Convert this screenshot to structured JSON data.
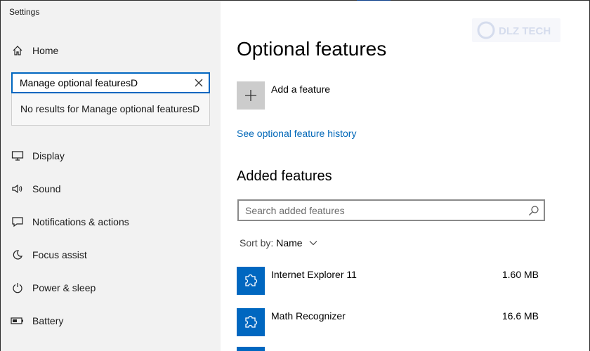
{
  "window": {
    "title": "Settings"
  },
  "sidebar": {
    "home_label": "Home",
    "search": {
      "value": "Manage optional featuresD",
      "no_results": "No results for Manage optional featuresD"
    },
    "items": [
      {
        "label": "Display",
        "icon": "display-icon"
      },
      {
        "label": "Sound",
        "icon": "sound-icon"
      },
      {
        "label": "Notifications & actions",
        "icon": "notifications-icon"
      },
      {
        "label": "Focus assist",
        "icon": "focus-assist-icon"
      },
      {
        "label": "Power & sleep",
        "icon": "power-icon"
      },
      {
        "label": "Battery",
        "icon": "battery-icon"
      }
    ]
  },
  "main": {
    "title": "Optional features",
    "add_feature_label": "Add a feature",
    "history_link": "See optional feature history",
    "added_section_title": "Added features",
    "search_placeholder": "Search added features",
    "sort_label": "Sort by:",
    "sort_value": "Name",
    "features": [
      {
        "name": "Internet Explorer 11",
        "size": "1.60 MB"
      },
      {
        "name": "Math Recognizer",
        "size": "16.6 MB"
      }
    ]
  },
  "watermark": {
    "text": "DLZ TECH"
  },
  "colors": {
    "accent": "#0067c0",
    "link": "#0067b8",
    "sidebar_bg": "#f2f2f2",
    "tile_gray": "#cccccc"
  }
}
